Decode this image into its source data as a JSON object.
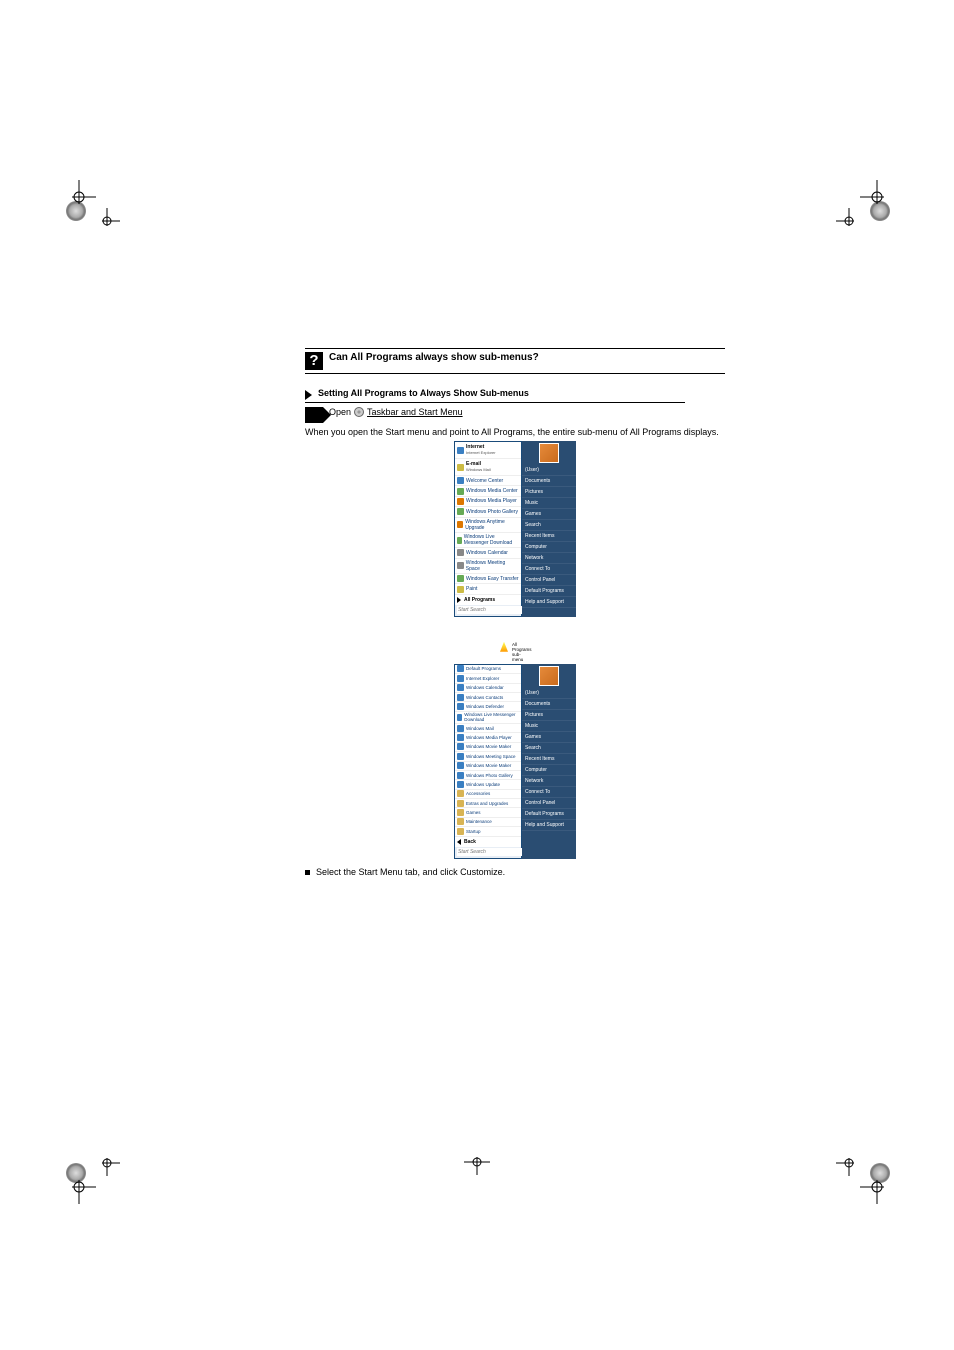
{
  "question": "Can All Programs always show sub-menus?",
  "step": {
    "title": "Setting All Programs to Always Show Sub-menus",
    "open_prefix": "Open",
    "open_link": "Taskbar and Start Menu"
  },
  "note": "When you open the Start menu and point to All Programs, the entire sub-menu of All Programs displays.",
  "start_menu": {
    "left": {
      "ie": {
        "title": "Internet",
        "sub": "Internet Explorer"
      },
      "mail": {
        "title": "E-mail",
        "sub": "Windows Mail"
      },
      "items": [
        "Welcome Center",
        "Windows Media Center",
        "Windows Media Player",
        "Windows Photo Gallery",
        "Windows Anytime Upgrade",
        "Windows Live Messenger Download",
        "Windows Calendar",
        "Windows Meeting Space",
        "Windows Easy Transfer",
        "Paint"
      ],
      "all_programs": "All Programs",
      "search_ph": "Start Search"
    },
    "right": [
      "(User)",
      "Documents",
      "Pictures",
      "Music",
      "Games",
      "Search",
      "Recent Items",
      "Computer",
      "Network",
      "Connect To",
      "Control Panel",
      "Default Programs",
      "Help and Support"
    ]
  },
  "all_programs_note": "All Programs sub-menu",
  "all_programs_menu": {
    "left": {
      "programs": [
        "Default Programs",
        "Internet Explorer",
        "Windows Calendar",
        "Windows Contacts",
        "Windows Defender",
        "Windows Live Messenger Download",
        "Windows Mail",
        "Windows Media Player",
        "Windows Movie Maker",
        "Windows Meeting Space",
        "Windows Movie Maker",
        "Windows Photo Gallery",
        "Windows Update"
      ],
      "folders": [
        "Accessories",
        "Extras and Upgrades",
        "Games",
        "Maintenance",
        "Startup"
      ],
      "back": "Back",
      "search_ph": "Start Search"
    },
    "right": [
      "(User)",
      "Documents",
      "Pictures",
      "Music",
      "Games",
      "Search",
      "Recent Items",
      "Computer",
      "Network",
      "Connect To",
      "Control Panel",
      "Default Programs",
      "Help and Support"
    ]
  },
  "select_instruction": "Select the Start Menu tab, and click Customize."
}
